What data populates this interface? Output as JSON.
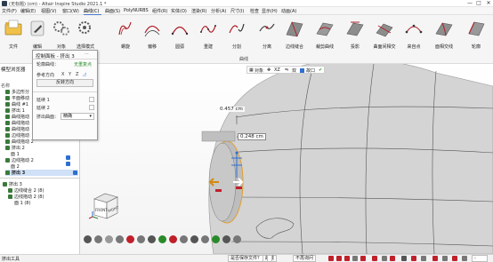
{
  "titlebar": {
    "title": "(无标题) (cm) - Altair Inspire Studio 2021.1 *",
    "minimize": "—",
    "maximize": "□",
    "close": "✕"
  },
  "menu": {
    "items": [
      "文件(F)",
      "编辑(E)",
      "视图(V)",
      "窗口(W)",
      "曲线(C)",
      "曲面(S)",
      "PolyNURBS",
      "组件(R)",
      "实体(O)",
      "渲染(R)",
      "分析(A)",
      "尺寸(I)",
      "检查",
      "显示(H)",
      "动画(A)"
    ],
    "active_index": 4
  },
  "ribbon": {
    "tools": [
      {
        "label": "文件",
        "icon": "folder-icon"
      },
      {
        "label": "编辑",
        "icon": "pen-cursor-icon"
      },
      {
        "label": "对象",
        "icon": "gears-icon"
      },
      {
        "label": "选择模式",
        "icon": "select-gears-icon"
      },
      {
        "label": "螺旋",
        "icon": "spiral-icon"
      },
      {
        "label": "偏移",
        "icon": "offset-curve-icon"
      },
      {
        "label": "圆弧",
        "icon": "arc-icon"
      },
      {
        "label": "重建",
        "icon": "rebuild-curve-icon"
      },
      {
        "label": "分割",
        "icon": "split-curve-icon"
      },
      {
        "label": "分离",
        "icon": "detach-curve-icon"
      },
      {
        "label": "边线缝合",
        "icon": "edge-stitch-icon"
      },
      {
        "label": "裁剪曲线",
        "icon": "trim-curve-icon"
      },
      {
        "label": "投影",
        "icon": "project-curve-icon"
      },
      {
        "label": "曲面间相交",
        "icon": "surface-intersect-icon"
      },
      {
        "label": "来自点",
        "icon": "from-points-icon"
      },
      {
        "label": "面相交线",
        "icon": "face-intersect-icon"
      },
      {
        "label": "轮廓",
        "icon": "silhouette-icon"
      }
    ],
    "group_label": "曲线"
  },
  "browser": {
    "title": "模型浏览器",
    "rows": [
      {
        "label": "名称",
        "indent": 0
      },
      {
        "label": "多边形分",
        "indent": 1
      },
      {
        "label": "平面移动",
        "indent": 1
      },
      {
        "label": "曲线 #1",
        "indent": 1
      },
      {
        "label": "挤出 1",
        "indent": 1
      },
      {
        "label": "曲线拖动",
        "indent": 1
      },
      {
        "label": "曲线拖动",
        "indent": 1
      },
      {
        "label": "曲线拖动",
        "indent": 1
      },
      {
        "label": "边线拖动",
        "indent": 1
      },
      {
        "label": "曲线拖动 2",
        "indent": 1
      },
      {
        "label": "挤出 2",
        "indent": 1
      },
      {
        "label": "面 1",
        "indent": 2
      },
      {
        "label": "边线拖动 2",
        "indent": 1
      },
      {
        "label": "面 2",
        "indent": 2
      },
      {
        "label": "挤出 3",
        "indent": 1
      }
    ],
    "history_rows": [
      {
        "label": "挤出 3",
        "indent": 0
      },
      {
        "label": "边线缝合 2 (8)",
        "indent": 1
      },
      {
        "label": "边线拖动 2 (8)",
        "indent": 1
      },
      {
        "label": "面 1 (8)",
        "indent": 2
      }
    ]
  },
  "control_panel": {
    "title": "控制面板 - 挤出 3",
    "section": "轮廓曲线：",
    "section_value": "无重复点",
    "ref_dir_label": "参考方向",
    "axes": [
      "X",
      "Y",
      "Z"
    ],
    "reverse_btn": "反转方向",
    "ext1": "延续 1",
    "ext2": "延续 2",
    "end_label": "挤出曲面：",
    "end_value": "精确"
  },
  "viewport": {
    "dim1": "0.457 cm",
    "dim2": "0.248  cm",
    "view_cube_front": "FRONT",
    "view_cube_right": "RIGHT"
  },
  "view_toolbar": {
    "items": [
      "对象",
      "XZ",
      "双",
      "故口"
    ]
  },
  "statusbar": {
    "left": "挤出工具",
    "field1": "是否保存文件？",
    "field2": "曲线",
    "field3": "不再询问",
    "field4": "-"
  },
  "colors": {
    "accent": "#2f6fd0",
    "edge_orange": "#e0a030",
    "model": "#d3d3d3"
  }
}
